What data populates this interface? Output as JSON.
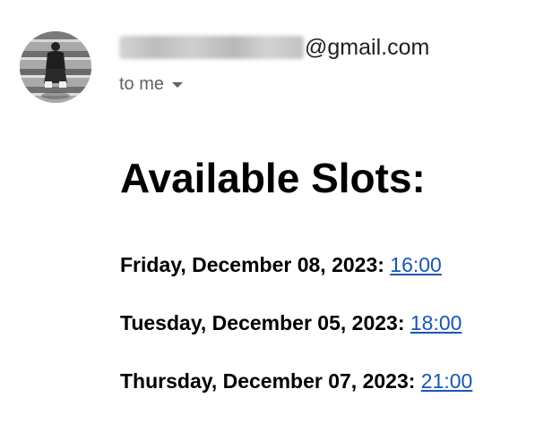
{
  "sender": {
    "email_domain": "@gmail.com",
    "recipient_label": "to me",
    "avatar_icon": "user-photo-avatar"
  },
  "email": {
    "heading": "Available Slots:",
    "slots": [
      {
        "date": "Friday, December 08, 2023:",
        "time": "16:00"
      },
      {
        "date": "Tuesday, December 05, 2023:",
        "time": "18:00"
      },
      {
        "date": "Thursday, December 07, 2023:",
        "time": "21:00"
      }
    ]
  },
  "colors": {
    "link": "#1a55b5",
    "secondary_text": "#5f6368",
    "heading": "#000000"
  }
}
